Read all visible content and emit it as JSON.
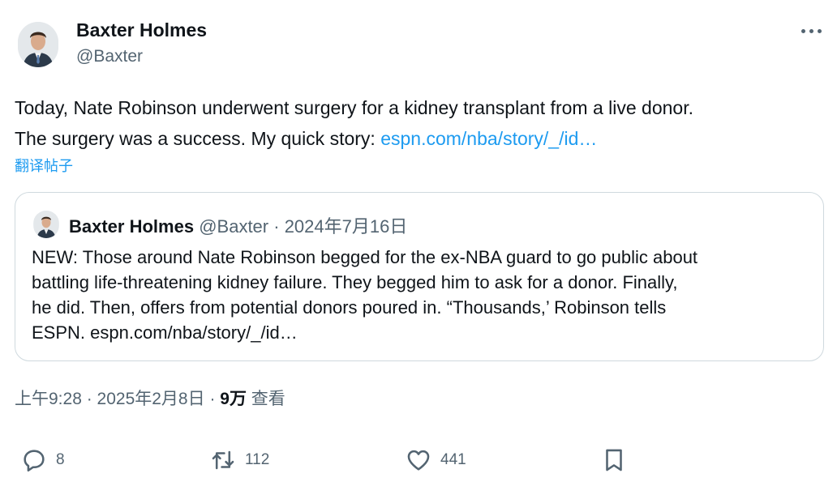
{
  "author": {
    "name": "Baxter Holmes",
    "handle": "@Baxter"
  },
  "tweet": {
    "text_line1": "Today, Nate Robinson underwent surgery for a kidney transplant from a live donor.",
    "text_line2": "The surgery was a success. My quick story: ",
    "link": "espn.com/nba/story/_/id…",
    "translate_label": "翻译帖子"
  },
  "quote": {
    "name": "Baxter Holmes",
    "handle": "@Baxter",
    "separator": " · ",
    "date": "2024年7月16日",
    "text_line1": "NEW: Those around Nate Robinson begged for the ex-NBA guard to go public about",
    "text_line2": "battling life-threatening kidney failure. They begged him to ask for a donor. Finally,",
    "text_line3": "he did. Then, offers from potential donors poured in. “Thousands,’ Robinson tells",
    "text_line4": "ESPN. espn.com/nba/story/_/id…"
  },
  "meta": {
    "time_date": "上午9:28 · 2025年2月8日 · ",
    "views_count": "9万",
    "views_label": " 查看"
  },
  "actions": {
    "replies": "8",
    "retweets": "112",
    "likes": "441"
  },
  "icons": [
    "more-icon",
    "reply-icon",
    "retweet-icon",
    "like-icon",
    "bookmark-icon"
  ],
  "colors": {
    "link": "#1d9bf0",
    "secondary_text": "#536471",
    "border": "#cfd9de"
  }
}
